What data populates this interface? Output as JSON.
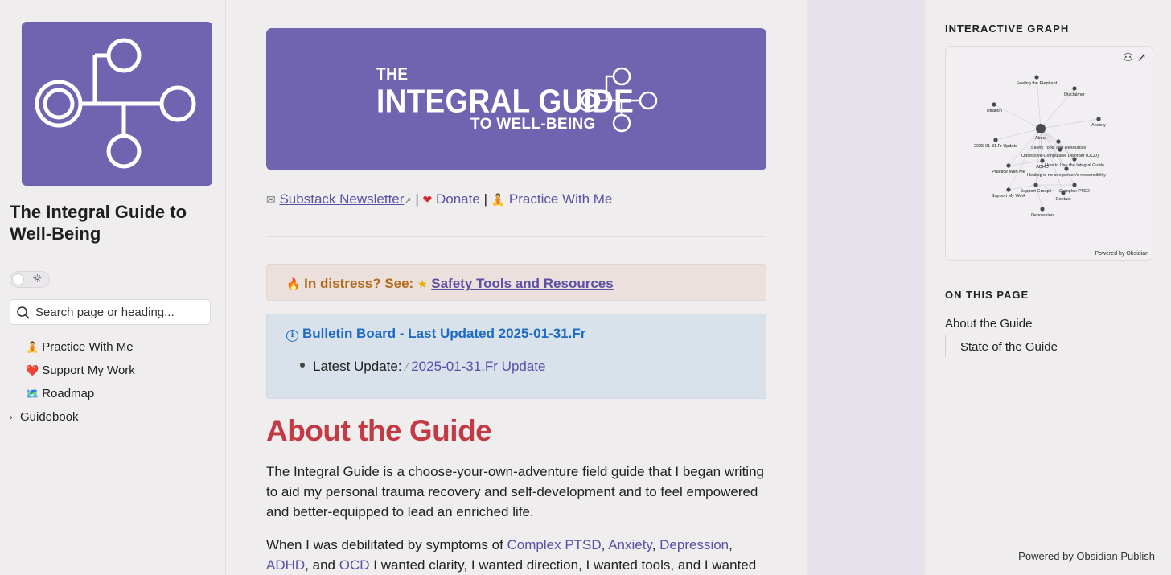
{
  "sidebar": {
    "site_title": "The Integral Guide to Well-Being",
    "search_placeholder": "Search page or heading...",
    "theme_icon": "sun-icon",
    "items": [
      {
        "emoji": "🧘",
        "label": "Practice With Me"
      },
      {
        "emoji": "❤️",
        "label": "Support My Work"
      },
      {
        "emoji": "🗺️",
        "label": "Roadmap"
      }
    ],
    "folder": {
      "label": "Guidebook",
      "icon": "chevron-right-icon"
    }
  },
  "banner": {
    "line1": "THE",
    "line2": "INTEGRAL GUIDE",
    "line3": "TO WELL-BEING"
  },
  "links": {
    "newsletter": "Substack Newsletter",
    "sep": "|",
    "donate": "Donate",
    "practice": "Practice With Me"
  },
  "callout_warn": {
    "prefix": "In distress? See:",
    "link": "Safety Tools and Resources"
  },
  "callout_info": {
    "title": "Bulletin Board - Last Updated 2025-01-31.Fr",
    "item_label": "Latest Update:",
    "item_link": "2025-01-31.Fr Update"
  },
  "content": {
    "heading": "About the Guide",
    "para1": "The Integral Guide is a choose-your-own-adventure field guide that I began writing to aid my personal trauma recovery and self-development and to feel empowered and better-equipped to lead an enriched life.",
    "para2_start": "When I was debilitated by symptoms of",
    "link_cptsd": "Complex PTSD",
    "link_anxiety": "Anxiety",
    "link_depression": "Depression",
    "link_adhd": "ADHD",
    "and": "and",
    "link_ocd": "OCD",
    "para2_end": "I wanted clarity, I wanted direction, I wanted tools, and I wanted"
  },
  "right": {
    "graph_label": "INTERACTIVE GRAPH",
    "graph_powered": "Powered by Obsidian",
    "toc_label": "ON THIS PAGE",
    "toc_items": [
      "About the Guide",
      "State of the Guide"
    ],
    "footer": "Powered by Obsidian Publish"
  },
  "graph_nodes": [
    {
      "label": "Feeling the Elephant"
    },
    {
      "label": "Disclaimer"
    },
    {
      "label": "Titration"
    },
    {
      "label": "Anxiety"
    },
    {
      "label": "About"
    },
    {
      "label": "2025-01-31.Fr Update"
    },
    {
      "label": "Safety Tools and Resources"
    },
    {
      "label": "Obsessive-Compulsive Disorder (OCD)"
    },
    {
      "label": "ADHD"
    },
    {
      "label": "How to Use the Integral Guide"
    },
    {
      "label": "Practice With Me"
    },
    {
      "label": "Healing is no one person's responsibility"
    },
    {
      "label": "Support Groups"
    },
    {
      "label": "Complex PTSD"
    },
    {
      "label": "Support My Work"
    },
    {
      "label": "Contact"
    },
    {
      "label": "Depression"
    }
  ],
  "colors": {
    "brand_purple": "#7063b0",
    "link": "#5c4fa6",
    "heading_red": "#c23a43",
    "warn_text": "#b46a1a",
    "info_blue": "#1d6bc4"
  }
}
